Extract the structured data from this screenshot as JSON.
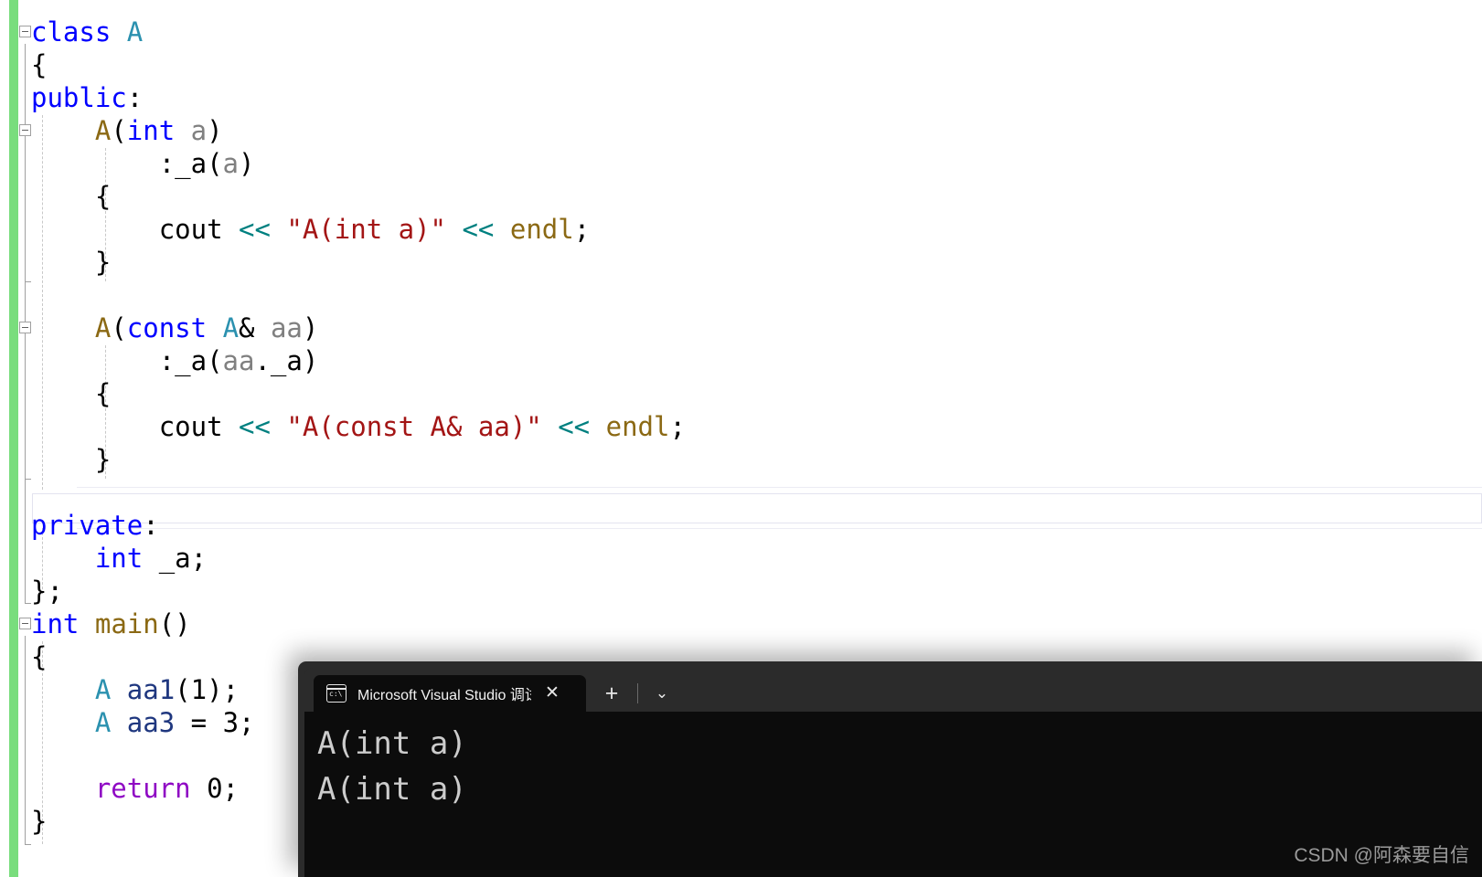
{
  "editor": {
    "language": "cpp",
    "change_bar_color": "#79dd7d",
    "current_line_number": 16,
    "code_lines": [
      {
        "indent": 0,
        "fold": "open",
        "tokens": [
          {
            "t": "class",
            "c": "kw"
          },
          {
            "t": " ",
            "c": "plain"
          },
          {
            "t": "A",
            "c": "type"
          }
        ]
      },
      {
        "indent": 0,
        "fold": null,
        "tokens": [
          {
            "t": "{",
            "c": "plain"
          }
        ]
      },
      {
        "indent": 0,
        "fold": null,
        "tokens": [
          {
            "t": "public",
            "c": "kw"
          },
          {
            "t": ":",
            "c": "plain"
          }
        ]
      },
      {
        "indent": 1,
        "fold": "open",
        "tokens": [
          {
            "t": "A",
            "c": "fn"
          },
          {
            "t": "(",
            "c": "plain"
          },
          {
            "t": "int",
            "c": "kw"
          },
          {
            "t": " ",
            "c": "plain"
          },
          {
            "t": "a",
            "c": "param"
          },
          {
            "t": ")",
            "c": "plain"
          }
        ]
      },
      {
        "indent": 2,
        "fold": null,
        "tokens": [
          {
            "t": ":_a(",
            "c": "plain"
          },
          {
            "t": "a",
            "c": "param"
          },
          {
            "t": ")",
            "c": "plain"
          }
        ]
      },
      {
        "indent": 1,
        "fold": null,
        "tokens": [
          {
            "t": "{",
            "c": "plain"
          }
        ]
      },
      {
        "indent": 2,
        "fold": null,
        "tokens": [
          {
            "t": "cout",
            "c": "plain"
          },
          {
            "t": " ",
            "c": "plain"
          },
          {
            "t": "<<",
            "c": "op"
          },
          {
            "t": " ",
            "c": "plain"
          },
          {
            "t": "\"A(int a)\"",
            "c": "str"
          },
          {
            "t": " ",
            "c": "plain"
          },
          {
            "t": "<<",
            "c": "op"
          },
          {
            "t": " ",
            "c": "plain"
          },
          {
            "t": "endl",
            "c": "fn"
          },
          {
            "t": ";",
            "c": "plain"
          }
        ]
      },
      {
        "indent": 1,
        "fold": null,
        "tokens": [
          {
            "t": "}",
            "c": "plain"
          }
        ]
      },
      {
        "indent": 1,
        "fold": null,
        "tokens": []
      },
      {
        "indent": 1,
        "fold": "open",
        "tokens": [
          {
            "t": "A",
            "c": "fn"
          },
          {
            "t": "(",
            "c": "plain"
          },
          {
            "t": "const",
            "c": "kw"
          },
          {
            "t": " ",
            "c": "plain"
          },
          {
            "t": "A",
            "c": "type"
          },
          {
            "t": "& ",
            "c": "plain"
          },
          {
            "t": "aa",
            "c": "param"
          },
          {
            "t": ")",
            "c": "plain"
          }
        ]
      },
      {
        "indent": 2,
        "fold": null,
        "tokens": [
          {
            "t": ":_a(",
            "c": "plain"
          },
          {
            "t": "aa",
            "c": "param"
          },
          {
            "t": ".",
            "c": "plain"
          },
          {
            "t": "_a",
            "c": "plain"
          },
          {
            "t": ")",
            "c": "plain"
          }
        ]
      },
      {
        "indent": 1,
        "fold": null,
        "tokens": [
          {
            "t": "{",
            "c": "plain"
          }
        ]
      },
      {
        "indent": 2,
        "fold": null,
        "tokens": [
          {
            "t": "cout",
            "c": "plain"
          },
          {
            "t": " ",
            "c": "plain"
          },
          {
            "t": "<<",
            "c": "op"
          },
          {
            "t": " ",
            "c": "plain"
          },
          {
            "t": "\"A(const A& aa)\"",
            "c": "str"
          },
          {
            "t": " ",
            "c": "plain"
          },
          {
            "t": "<<",
            "c": "op"
          },
          {
            "t": " ",
            "c": "plain"
          },
          {
            "t": "endl",
            "c": "fn"
          },
          {
            "t": ";",
            "c": "plain"
          }
        ]
      },
      {
        "indent": 1,
        "fold": null,
        "tokens": [
          {
            "t": "}",
            "c": "plain"
          }
        ]
      },
      {
        "indent": 1,
        "fold": null,
        "tokens": []
      },
      {
        "indent": 0,
        "fold": null,
        "tokens": [
          {
            "t": "private",
            "c": "kw"
          },
          {
            "t": ":",
            "c": "plain"
          }
        ]
      },
      {
        "indent": 1,
        "fold": null,
        "tokens": [
          {
            "t": "int",
            "c": "kw"
          },
          {
            "t": " _a;",
            "c": "plain"
          }
        ]
      },
      {
        "indent": 0,
        "fold": null,
        "tokens": [
          {
            "t": "};",
            "c": "plain"
          }
        ]
      },
      {
        "indent": 0,
        "fold": "open",
        "tokens": [
          {
            "t": "int",
            "c": "kw"
          },
          {
            "t": " ",
            "c": "plain"
          },
          {
            "t": "main",
            "c": "fn"
          },
          {
            "t": "()",
            "c": "plain"
          }
        ]
      },
      {
        "indent": 0,
        "fold": null,
        "tokens": [
          {
            "t": "{",
            "c": "plain"
          }
        ]
      },
      {
        "indent": 1,
        "fold": null,
        "tokens": [
          {
            "t": "A",
            "c": "type"
          },
          {
            "t": " ",
            "c": "plain"
          },
          {
            "t": "aa1",
            "c": "local"
          },
          {
            "t": "(",
            "c": "plain"
          },
          {
            "t": "1",
            "c": "num"
          },
          {
            "t": ");",
            "c": "plain"
          }
        ]
      },
      {
        "indent": 1,
        "fold": null,
        "tokens": [
          {
            "t": "A",
            "c": "type"
          },
          {
            "t": " ",
            "c": "plain"
          },
          {
            "t": "aa3",
            "c": "local"
          },
          {
            "t": " = ",
            "c": "plain"
          },
          {
            "t": "3",
            "c": "num"
          },
          {
            "t": ";",
            "c": "plain"
          }
        ]
      },
      {
        "indent": 1,
        "fold": null,
        "tokens": []
      },
      {
        "indent": 1,
        "fold": null,
        "tokens": [
          {
            "t": "return",
            "c": "ctl"
          },
          {
            "t": " ",
            "c": "plain"
          },
          {
            "t": "0",
            "c": "num"
          },
          {
            "t": ";",
            "c": "plain"
          }
        ]
      },
      {
        "indent": 0,
        "fold": null,
        "tokens": [
          {
            "t": "}",
            "c": "plain"
          }
        ]
      }
    ]
  },
  "console": {
    "tab": {
      "icon": "console-window-icon",
      "icon_glyph": "c:\\",
      "title": "Microsoft Visual Studio 调试控",
      "close_label": "✕"
    },
    "new_tab_label": "+",
    "dropdown_label": "⌄",
    "output_lines": [
      "A(int a)",
      "A(int a)"
    ],
    "background_color": "#0c0c0c",
    "titlebar_color": "#2b2b2b",
    "text_color": "#cccccc"
  },
  "watermark": {
    "text": "CSDN @阿森要自信"
  }
}
